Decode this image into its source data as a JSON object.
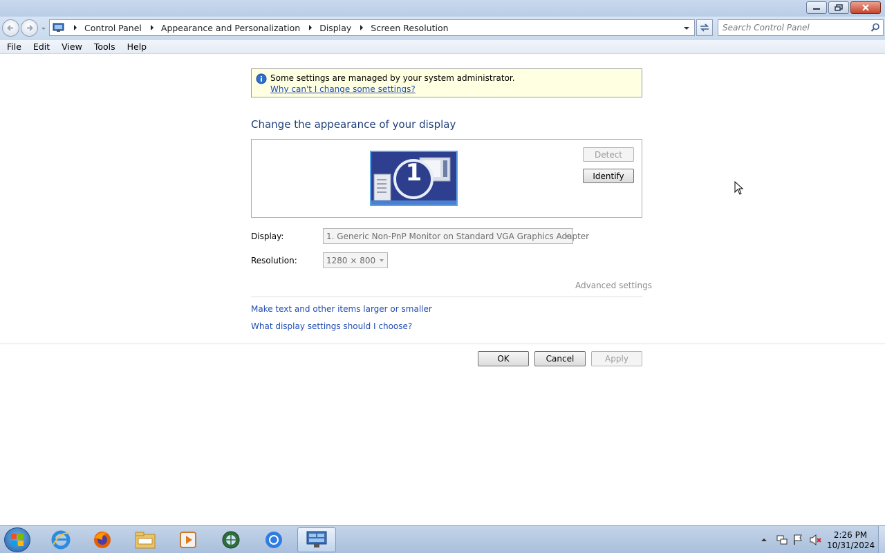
{
  "window": {
    "minimize_icon": "minimize-icon",
    "restore_icon": "restore-icon",
    "close_icon": "close-icon"
  },
  "address_bar": {
    "breadcrumbs": [
      "Control Panel",
      "Appearance and Personalization",
      "Display",
      "Screen Resolution"
    ],
    "search_placeholder": "Search Control Panel"
  },
  "menu": [
    "File",
    "Edit",
    "View",
    "Tools",
    "Help"
  ],
  "notice": {
    "message": "Some settings are managed by your system administrator.",
    "link": "Why can't I change some settings?"
  },
  "page": {
    "heading": "Change the appearance of your display",
    "monitor_number": "1",
    "detect_label": "Detect",
    "identify_label": "Identify",
    "display_label": "Display:",
    "display_value": "1. Generic Non-PnP Monitor on Standard VGA Graphics Adapter",
    "resolution_label": "Resolution:",
    "resolution_value": "1280 × 800",
    "advanced_settings": "Advanced settings",
    "link_text_size": "Make text and other items larger or smaller",
    "link_what_settings": "What display settings should I choose?"
  },
  "buttons": {
    "ok": "OK",
    "cancel": "Cancel",
    "apply": "Apply"
  },
  "taskbar": {
    "apps": [
      "internet-explorer",
      "firefox",
      "file-explorer",
      "media-player",
      "network-globe",
      "chrome",
      "control-panel"
    ],
    "time": "2:26 PM",
    "date": "10/31/2024"
  }
}
